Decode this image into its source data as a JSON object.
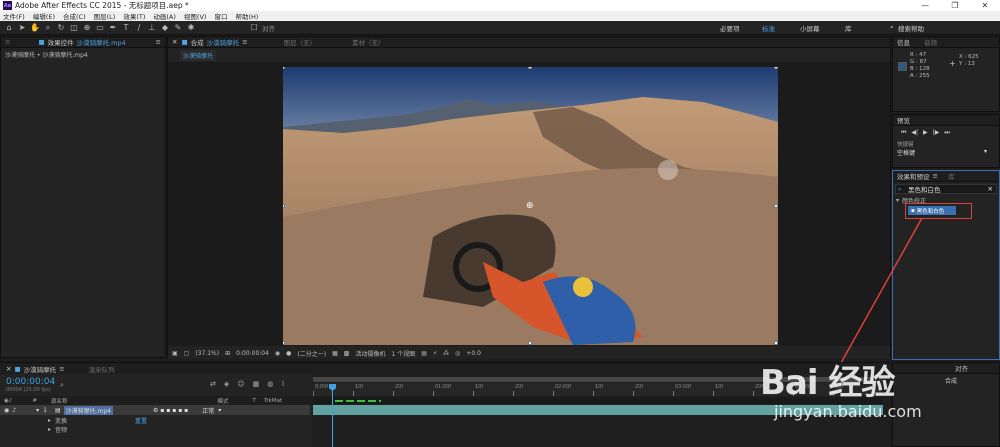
{
  "titlebar": {
    "logo_text": "Ae",
    "title": "Adobe After Effects CC 2015 - 无标题项目.aep *"
  },
  "menubar": {
    "items": [
      "文件(F)",
      "编辑(E)",
      "合成(C)",
      "图层(L)",
      "效果(T)",
      "动画(A)",
      "视图(V)",
      "窗口",
      "帮助(H)"
    ]
  },
  "toolbar": {
    "snap_label": "对齐",
    "workspaces": [
      "必要项",
      "标准",
      "小屏幕",
      "库"
    ],
    "active_workspace": "标准",
    "search_help": "搜索帮助"
  },
  "project_panel": {
    "tab_label": "效果控件",
    "tab_file": "沙漠骑摩托.mp4",
    "breadcrumb": "沙漠骑摩托 • 沙漠骑摩托.mp4"
  },
  "viewer": {
    "tab_comp": "合成",
    "tab_comp_name": "沙漠骑摩托",
    "tab_layer": "图层（无）",
    "tab_footage": "素材（无）",
    "comp_label": "沙漠骑摩托",
    "bar": {
      "zoom": "(37.1%)",
      "timecode": "0:00:00:04",
      "resolution": "(二分之一)",
      "camera": "活动摄像机",
      "views": "1 个视图",
      "exposure": "+0.0"
    }
  },
  "info_panel": {
    "tab_info": "信息",
    "tab_audio": "音频",
    "r": "R : 47",
    "g": "G : 87",
    "b": "B : 128",
    "a": "A : 255",
    "x": "X : 625",
    "y": "Y : 13",
    "swatch_color": "#2f5780"
  },
  "preview_panel": {
    "tab": "预览",
    "shortcut_label": "快捷键",
    "shortcut_value": "空格键"
  },
  "effects_panel": {
    "tab": "效果和预设",
    "tab2": "库",
    "search_value": "黑色和白色",
    "category": "颜色校正",
    "result_item": "黑色和白色"
  },
  "align_panel": {
    "tab": "对齐",
    "target": "合成"
  },
  "timeline": {
    "tab_comp": "沙漠骑摩托",
    "tab_render": "渲染队列",
    "timecode": "0:00:00:04",
    "fps": "00004 (25.00 fps)",
    "col_source": "源名称",
    "col_mode": "模式",
    "col_t": "T",
    "col_trkmat": "TrkMat",
    "layer_num": "1",
    "layer_name": "沙漠骑摩托.mp4",
    "layer_mode": "正常",
    "prop_transform": "变换",
    "prop_reset": "重置",
    "prop_audio": "音频",
    "ruler_ticks": [
      "0:00f",
      "10f",
      "20f",
      "01:00f",
      "10f",
      "20f",
      "02:00f",
      "10f",
      "20f",
      "03:00f",
      "10f",
      "20f",
      "04:00f",
      "10f"
    ]
  },
  "watermark": {
    "text": "Bai 经验",
    "url": "jingyan.baidu.com"
  }
}
